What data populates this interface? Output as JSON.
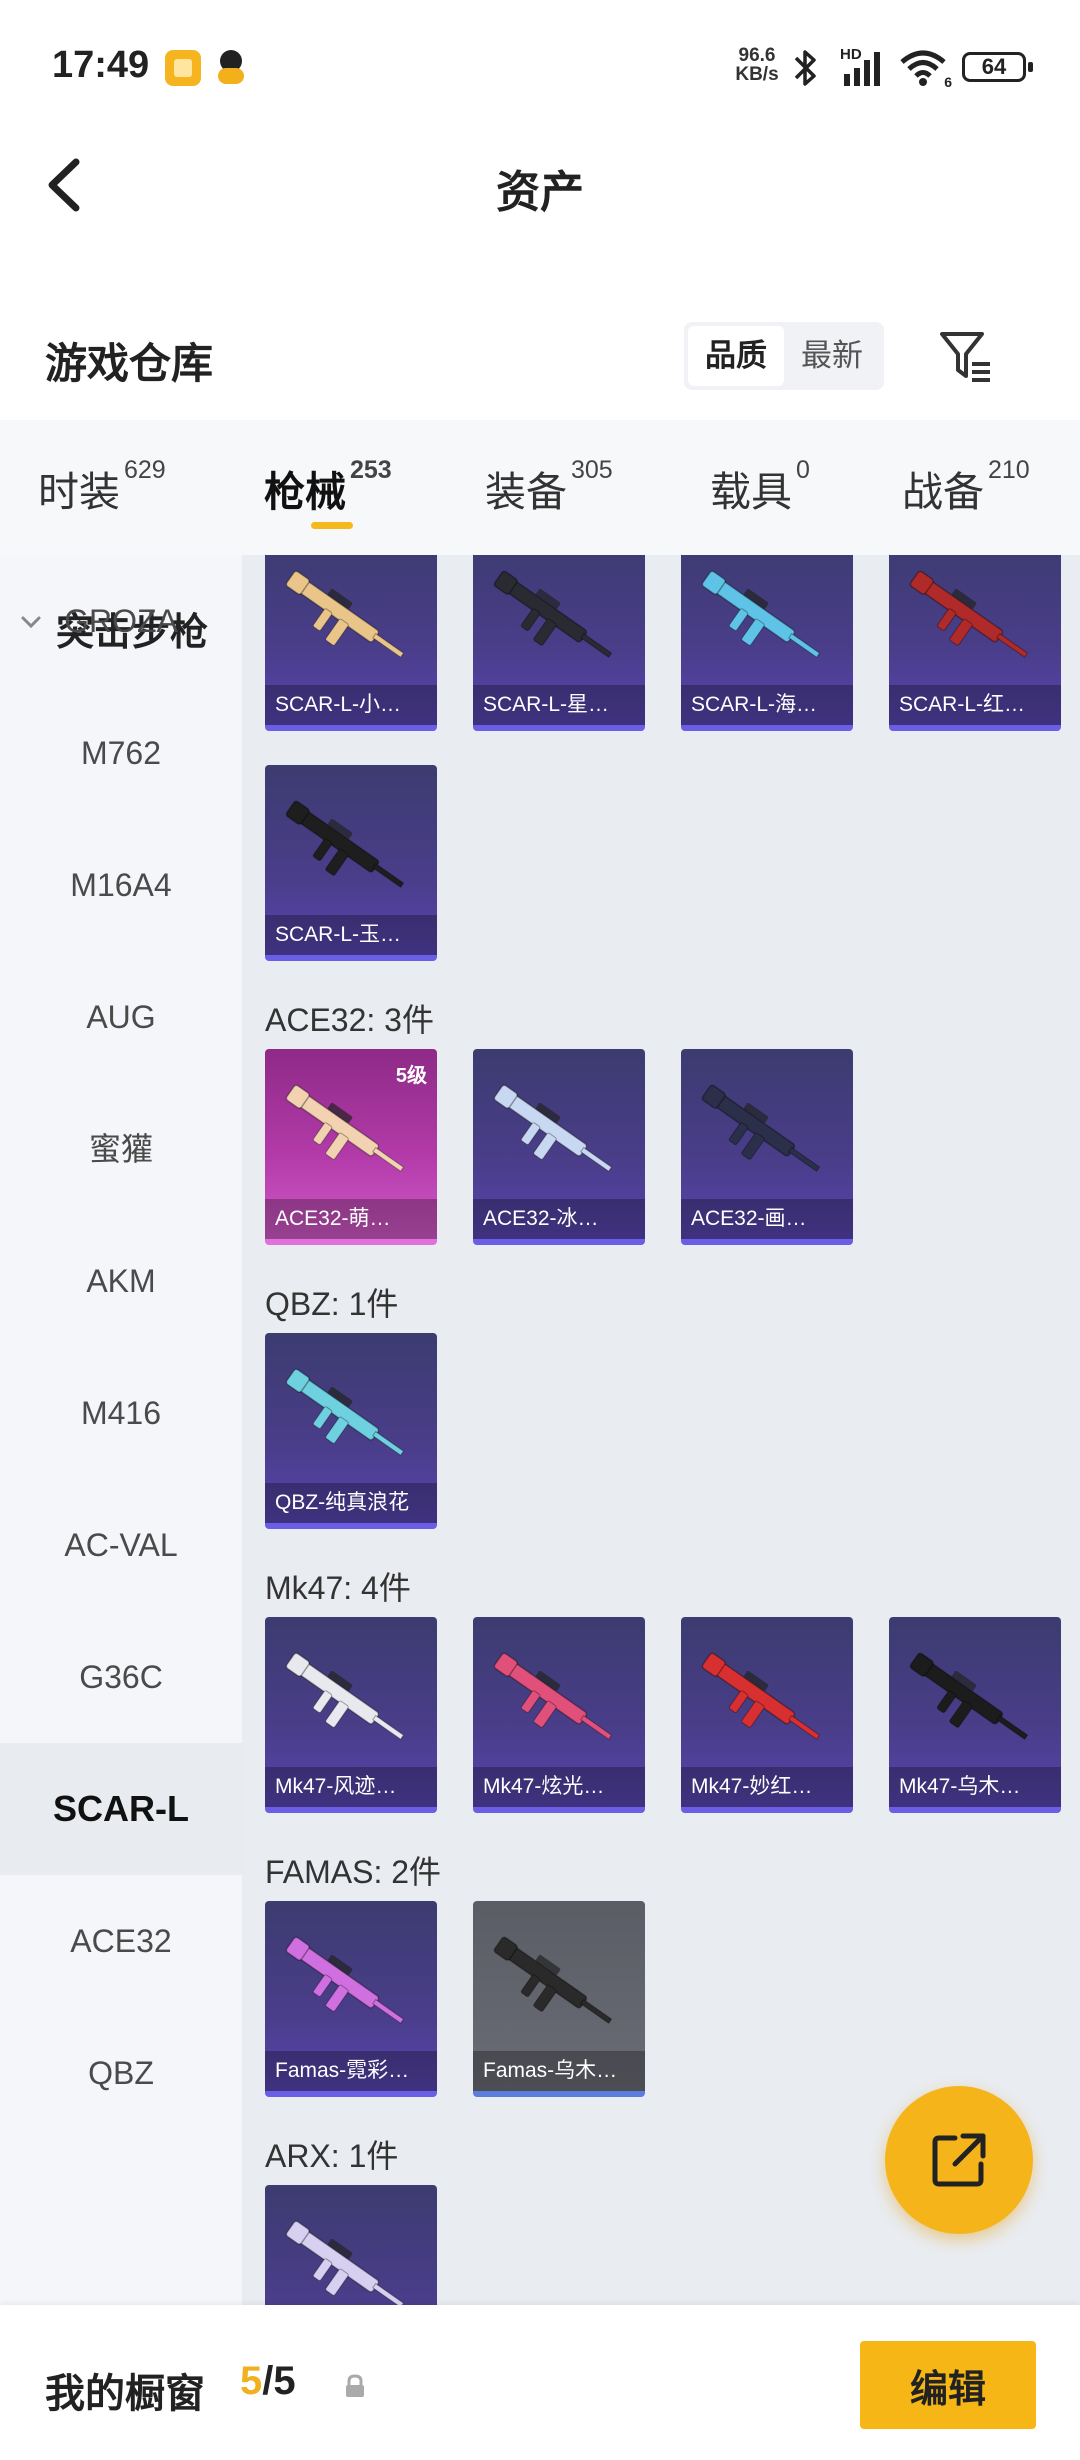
{
  "status_bar": {
    "time": "17:49",
    "net_speed_value": "96.6",
    "net_speed_unit": "KB/s",
    "signal_label": "HD",
    "wifi_label": "6",
    "battery": "64"
  },
  "header": {
    "title": "资产"
  },
  "warehouse": {
    "title": "游戏仓库",
    "sort_options": [
      "品质",
      "最新"
    ],
    "selected_sort": "品质"
  },
  "tabs": [
    {
      "label": "时装",
      "count": "629"
    },
    {
      "label": "枪械",
      "count": "253",
      "active": true
    },
    {
      "label": "装备",
      "count": "305"
    },
    {
      "label": "载具",
      "count": "0"
    },
    {
      "label": "战备",
      "count": "210"
    }
  ],
  "sidebar": {
    "category": "突击步枪",
    "items": [
      "GROZA",
      "M762",
      "M16A4",
      "AUG",
      "蜜獾",
      "AKM",
      "M416",
      "AC-VAL",
      "G36C",
      "SCAR-L",
      "ACE32",
      "QBZ"
    ],
    "active": "SCAR-L"
  },
  "groups": [
    {
      "label": "",
      "items": [
        {
          "name": "SCAR-L-小…",
          "gun_color": "#e9c58a"
        },
        {
          "name": "SCAR-L-星…",
          "gun_color": "#2a2a33"
        },
        {
          "name": "SCAR-L-海…",
          "gun_color": "#5fc3e8"
        },
        {
          "name": "SCAR-L-红…",
          "gun_color": "#b02a2a"
        },
        {
          "name": "SCAR-L-玉…",
          "gun_color": "#1e1e1e"
        }
      ]
    },
    {
      "label": "ACE32: 3件",
      "items": [
        {
          "name": "ACE32-萌…",
          "gun_color": "#f2d2b0",
          "level": "5级",
          "style": "pink"
        },
        {
          "name": "ACE32-冰…",
          "gun_color": "#c9d8f2"
        },
        {
          "name": "ACE32-画…",
          "gun_color": "#2b2f4a"
        }
      ]
    },
    {
      "label": "QBZ: 1件",
      "items": [
        {
          "name": "QBZ-纯真浪花",
          "gun_color": "#6fd0e0"
        }
      ]
    },
    {
      "label": "Mk47: 4件",
      "items": [
        {
          "name": "Mk47-风迹…",
          "gun_color": "#e8e8ef"
        },
        {
          "name": "Mk47-炫光…",
          "gun_color": "#e0507a"
        },
        {
          "name": "Mk47-妙红…",
          "gun_color": "#d83030"
        },
        {
          "name": "Mk47-乌木…",
          "gun_color": "#1c1c1c"
        }
      ]
    },
    {
      "label": "FAMAS: 2件",
      "items": [
        {
          "name": "Famas-霓彩…",
          "gun_color": "#d070e0"
        },
        {
          "name": "Famas-乌木…",
          "gun_color": "#2a2a2a",
          "style": "grey"
        }
      ]
    },
    {
      "label": "ARX: 1件",
      "items": [
        {
          "name": "",
          "gun_color": "#d8d0f0"
        }
      ]
    }
  ],
  "bottom_bar": {
    "label": "我的橱窗",
    "count_current": "5",
    "count_total": "/5",
    "edit_label": "编辑"
  },
  "colors": {
    "accent": "#f6b716",
    "card_purple": "#4a3d8a",
    "card_pink": "#b23aa8",
    "card_grey": "#6a6c75",
    "sidebar_bg": "#f4f6f9",
    "content_bg": "#e9ecf1"
  }
}
